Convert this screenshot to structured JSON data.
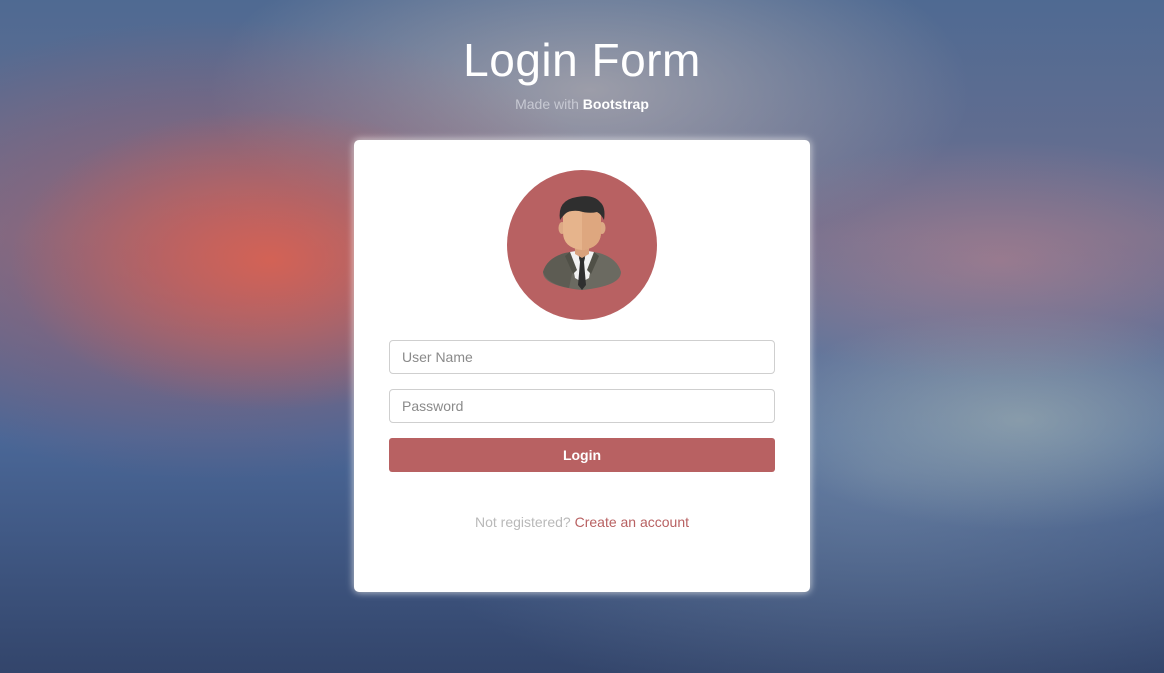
{
  "header": {
    "title": "Login Form",
    "subtitle_prefix": "Made with",
    "subtitle_brand": "Bootstrap"
  },
  "form": {
    "avatar_icon": "businessman-avatar-icon",
    "username_placeholder": "User Name",
    "username_value": "",
    "password_placeholder": "Password",
    "password_value": "",
    "submit_label": "Login",
    "footer_text": "Not registered?",
    "footer_link": "Create an account"
  },
  "colors": {
    "accent": "#b86162",
    "card_background": "#ffffff",
    "title_text": "#ffffff"
  }
}
